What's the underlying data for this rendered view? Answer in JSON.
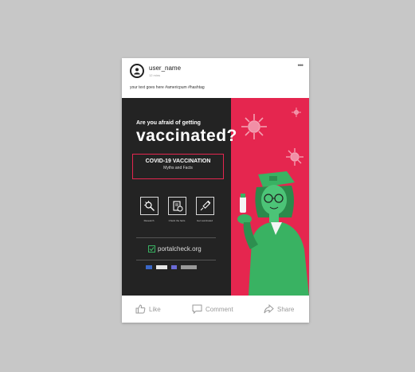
{
  "post": {
    "user_name": "user_name",
    "subline": "12 mins",
    "more": "•••",
    "caption": "your text goes here #americpum #hashtag"
  },
  "poster": {
    "question": "Are you afraid of getting",
    "headline": "vaccinated?",
    "covid_title": "COVID-19 VACCINATION",
    "covid_sub": "Myths and Facts",
    "items": [
      {
        "label": "Research",
        "icon": "virus-search-icon"
      },
      {
        "label": "Check the facts",
        "icon": "document-check-icon"
      },
      {
        "label": "Get vaccinated",
        "icon": "syringe-icon"
      }
    ],
    "website": "portalcheck.org",
    "logos": [
      "EU logo",
      "partner logo",
      "sponsor"
    ],
    "colors": {
      "dark": "#232323",
      "accent": "#e5264f",
      "nurse": "#39b262"
    }
  },
  "actions": {
    "like": "Like",
    "comment": "Comment",
    "share": "Share"
  }
}
